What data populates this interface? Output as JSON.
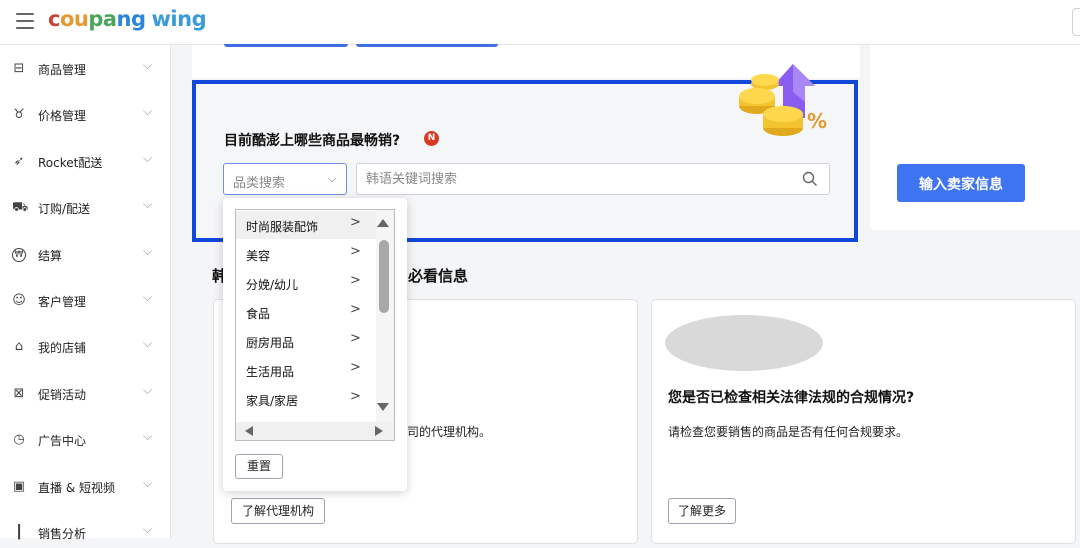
{
  "header": {
    "logo_parts": [
      "c",
      "ou",
      "pa",
      "ng"
    ],
    "logo_wing": "wing"
  },
  "sidebar": {
    "items": [
      {
        "label": "商品管理",
        "icon": "box-icon",
        "top": 0
      },
      {
        "label": "价格管理",
        "icon": "price-tag-icon"
      },
      {
        "label": "Rocket配送",
        "icon": "rocket-icon"
      },
      {
        "label": "订购/配送",
        "icon": "truck-icon"
      },
      {
        "label": "结算",
        "icon": "won-coin-icon"
      },
      {
        "label": "客户管理",
        "icon": "smiley-icon"
      },
      {
        "label": "我的店铺",
        "icon": "store-icon"
      },
      {
        "label": "促销活动",
        "icon": "promotion-icon"
      },
      {
        "label": "广告中心",
        "icon": "clock-icon"
      },
      {
        "label": "直播 & 短视频",
        "icon": "live-video-icon"
      },
      {
        "label": "销售分析",
        "icon": "chart-icon"
      }
    ]
  },
  "search": {
    "question": "目前酷澎上哪些商品最畅销?",
    "badge": "N",
    "category_placeholder": "品类搜索",
    "keyword_placeholder": "韩语关键词搜索"
  },
  "dropdown": {
    "options": [
      "时尚服装配饰",
      "美容",
      "分娩/幼儿",
      "食品",
      "厨房用品",
      "生活用品",
      "家具/家居"
    ],
    "reset_label": "重置"
  },
  "right_card": {
    "button_label": "输入卖家信息"
  },
  "section": {
    "title_left": "韩",
    "title_right": "必看信息"
  },
  "card_a": {
    "desc_fragment": "司的代理机构。",
    "button_label": "了解代理机构"
  },
  "card_b": {
    "title": "您是否已检查相关法律法规的合规情况?",
    "desc": "请检查您要销售的商品是否有任何合规要求。",
    "button_label": "了解更多"
  },
  "colors": {
    "highlight_border": "#1248d9",
    "primary_button": "#3e74f2",
    "badge": "#d63a1f"
  }
}
